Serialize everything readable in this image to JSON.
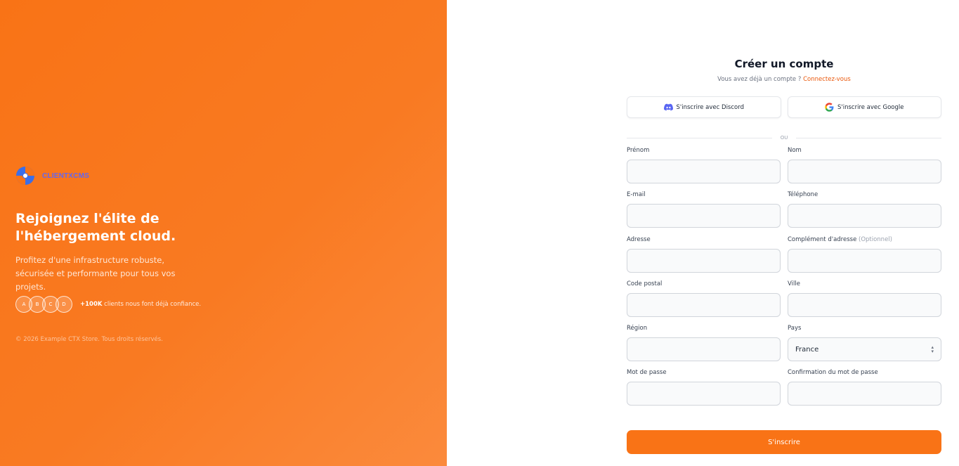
{
  "brand": {
    "name": "CLIENTXCMS"
  },
  "hero": {
    "headline": "Rejoignez l'élite de l'hébergement cloud.",
    "subtext": "Profitez d'une infrastructure robuste, sécurisée et performante pour tous vos projets.",
    "avatars": [
      "A",
      "B",
      "C",
      "D"
    ],
    "trust_count": "+100K",
    "trust_text": " clients nous font déjà confiance.",
    "copyright": "© 2026 Example CTX Store. Tous droits réservés."
  },
  "form": {
    "title": "Créer un compte",
    "login_prompt": "Vous avez déjà un compte ?",
    "login_link": "Connectez-vous",
    "discord_label": "S'inscrire avec Discord",
    "google_label": "S'inscrire avec Google",
    "divider": "OU",
    "fields": {
      "firstname": "Prénom",
      "lastname": "Nom",
      "email": "E-mail",
      "phone": "Téléphone",
      "address": "Adresse",
      "address2": "Complément d'adresse",
      "address2_optional": "(Optionnel)",
      "zipcode": "Code postal",
      "city": "Ville",
      "region": "Région",
      "country": "Pays",
      "country_value": "France",
      "password": "Mot de passe",
      "password_confirm": "Confirmation du mot de passe"
    },
    "submit": "S'inscrire"
  },
  "colors": {
    "accent": "#f97316",
    "link": "#ea580c",
    "brand_text": "#6366f1",
    "discord": "#5865F2"
  }
}
